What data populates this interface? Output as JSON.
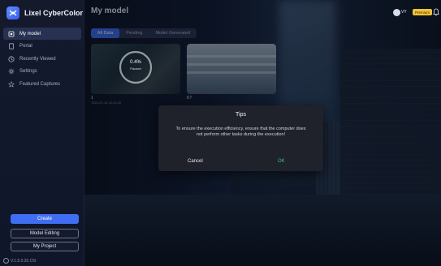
{
  "app": {
    "brand": "Lixel CyberColor"
  },
  "sidebar": {
    "items": [
      {
        "label": "My model",
        "icon": "model-icon",
        "active": true
      },
      {
        "label": "Portal",
        "icon": "portal-icon",
        "active": false
      },
      {
        "label": "Recently Viewed",
        "icon": "clock-icon",
        "active": false
      },
      {
        "label": "Settings",
        "icon": "gear-icon",
        "active": false
      },
      {
        "label": "Featured Captures",
        "icon": "star-icon",
        "active": false
      }
    ],
    "create_label": "Create",
    "model_editing_label": "Model Editing",
    "my_project_label": "My Project",
    "version": "V.1.5.0.20.CN"
  },
  "header": {
    "title": "My model",
    "user": "VY",
    "badge": "Premium"
  },
  "tabs": [
    {
      "label": "All Data",
      "active": true
    },
    {
      "label": "Pending",
      "active": false
    },
    {
      "label": "Model Generated",
      "active": false
    }
  ],
  "cards": [
    {
      "name": "1",
      "date": "2024-07-15 10:24:41",
      "progress": "0.4%",
      "state": "Paused",
      "progress_value": 0.004
    },
    {
      "name": "K7",
      "date": "",
      "progress": "",
      "state": ""
    }
  ],
  "dialog": {
    "title": "Tips",
    "message": "To ensure the execution efficiency, ensure that the computer does not perform other tasks during the execution!",
    "cancel_label": "Cancel",
    "ok_label": "OK"
  },
  "colors": {
    "accent": "#3f6ef3",
    "ok": "#39c27a",
    "premium": "#f0c23a"
  }
}
